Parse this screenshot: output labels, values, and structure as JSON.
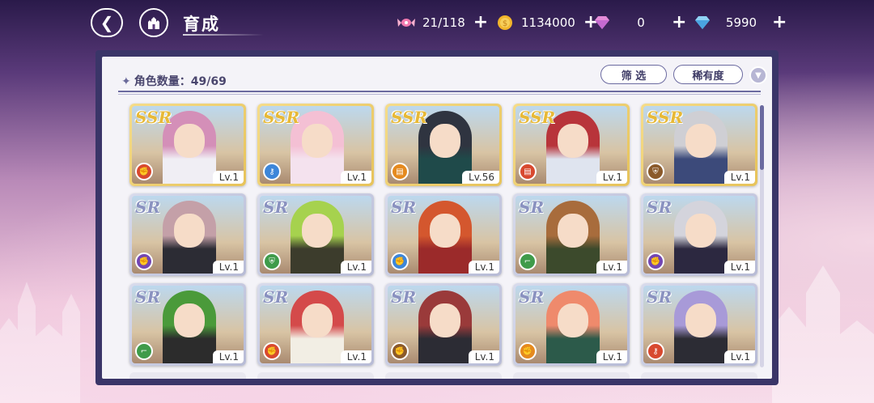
{
  "header": {
    "title": "育成",
    "back_icon": "back-arrow-icon",
    "home_icon": "castle-icon"
  },
  "resources": [
    {
      "name": "candy",
      "icon": "candy-icon",
      "value": "21/118"
    },
    {
      "name": "coin",
      "icon": "coin-icon",
      "value": "1134000"
    },
    {
      "name": "pink-gem",
      "icon": "pink-gem-icon",
      "value": "0"
    },
    {
      "name": "blue-gem",
      "icon": "blue-gem-icon",
      "value": "5990"
    }
  ],
  "panel": {
    "count_label": "角色数量：49/69",
    "filter_label": "筛 选",
    "rarity_label": "稀有度",
    "sort_icon": "chevron-down-icon"
  },
  "colors": {
    "ssr": "#e7b937",
    "sr": "#8a92c0",
    "class_red": "#d8492f",
    "class_blue": "#3d86d9",
    "class_orange": "#e58a1f",
    "class_brown": "#8b5a2b",
    "class_purple": "#7346b3",
    "class_green": "#3f9b4a"
  },
  "characters": [
    {
      "rarity": "SSR",
      "level": "Lv.1",
      "class": "red",
      "class_icon": "fist-icon",
      "hair": "#d48fb8",
      "outfit": "#f0eef4"
    },
    {
      "rarity": "SSR",
      "level": "Lv.1",
      "class": "blue",
      "class_icon": "key-icon",
      "hair": "#f4c0d4",
      "outfit": "#f4e2ee"
    },
    {
      "rarity": "SSR",
      "level": "Lv.56",
      "class": "orange",
      "class_icon": "book-icon",
      "hair": "#2f3440",
      "outfit": "#1f4a4a"
    },
    {
      "rarity": "SSR",
      "level": "Lv.1",
      "class": "red",
      "class_icon": "book-icon",
      "hair": "#b8343a",
      "outfit": "#dfe4ef"
    },
    {
      "rarity": "SSR",
      "level": "Lv.1",
      "class": "brown",
      "class_icon": "shield-icon",
      "hair": "#cfcfd4",
      "outfit": "#3c4a7a"
    },
    {
      "rarity": "SR",
      "level": "Lv.1",
      "class": "purple",
      "class_icon": "fist-icon",
      "hair": "#c4a0a8",
      "outfit": "#2c2c34"
    },
    {
      "rarity": "SR",
      "level": "Lv.1",
      "class": "green",
      "class_icon": "shield-icon",
      "hair": "#a6d24e",
      "outfit": "#3c3c2c"
    },
    {
      "rarity": "SR",
      "level": "Lv.1",
      "class": "blue",
      "class_icon": "fist-icon",
      "hair": "#d4572e",
      "outfit": "#9b2a2a"
    },
    {
      "rarity": "SR",
      "level": "Lv.1",
      "class": "green",
      "class_icon": "boot-icon",
      "hair": "#a86c3c",
      "outfit": "#3c4a2c"
    },
    {
      "rarity": "SR",
      "level": "Lv.1",
      "class": "purple",
      "class_icon": "fist-icon",
      "hair": "#d4d4dc",
      "outfit": "#2c2840"
    },
    {
      "rarity": "SR",
      "level": "Lv.1",
      "class": "green",
      "class_icon": "boot-icon",
      "hair": "#4a9a3a",
      "outfit": "#2c2c2c"
    },
    {
      "rarity": "SR",
      "level": "Lv.1",
      "class": "red",
      "class_icon": "fist-icon",
      "hair": "#d44a4a",
      "outfit": "#f2eee4"
    },
    {
      "rarity": "SR",
      "level": "Lv.1",
      "class": "brown",
      "class_icon": "fist-icon",
      "hair": "#9a3a3a",
      "outfit": "#2c2c34"
    },
    {
      "rarity": "SR",
      "level": "Lv.1",
      "class": "orange",
      "class_icon": "fist-icon",
      "hair": "#ef8a6c",
      "outfit": "#2c5a4a"
    },
    {
      "rarity": "SR",
      "level": "Lv.1",
      "class": "red",
      "class_icon": "key-icon",
      "hair": "#a89ad8",
      "outfit": "#2c2c34"
    }
  ]
}
